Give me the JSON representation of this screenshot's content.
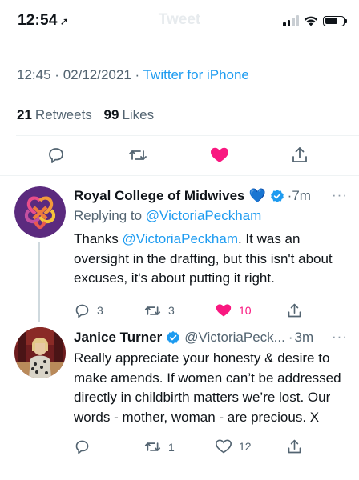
{
  "status_bar": {
    "time": "12:54",
    "ghost_title": "Tweet"
  },
  "tweet_meta": {
    "time": "12:45",
    "date": "02/12/2021",
    "separator": "·",
    "source": "Twitter for iPhone"
  },
  "engagement": {
    "retweets_count": "21",
    "retweets_label": "Retweets",
    "likes_count": "99",
    "likes_label": "Likes"
  },
  "replies": [
    {
      "name": "Royal College of Midwives",
      "emoji": "💙",
      "time": "7m",
      "replying_prefix": "Replying to",
      "replying_to": "@VictoriaPeckham",
      "text_prefix": "Thanks",
      "mention": "@VictoriaPeckham",
      "text_rest": ". It was an oversight in the drafting, but this isn't about excuses, it's about putting it right.",
      "reply_count": "3",
      "retweet_count": "3",
      "like_count": "10"
    },
    {
      "name": "Janice Turner",
      "handle": "@VictoriaPeck...",
      "time": "3m",
      "text": "Really appreciate your honesty & desire to make amends. If women can’t be addressed directly in childbirth matters we’re lost. Our words - mother, woman - are precious. X",
      "reply_count": "",
      "retweet_count": "1",
      "like_count": "12"
    }
  ],
  "more_label": "···",
  "colors": {
    "brand_blue": "#1d9bf0",
    "like_pink": "#f91880",
    "secondary_text": "#536471"
  }
}
